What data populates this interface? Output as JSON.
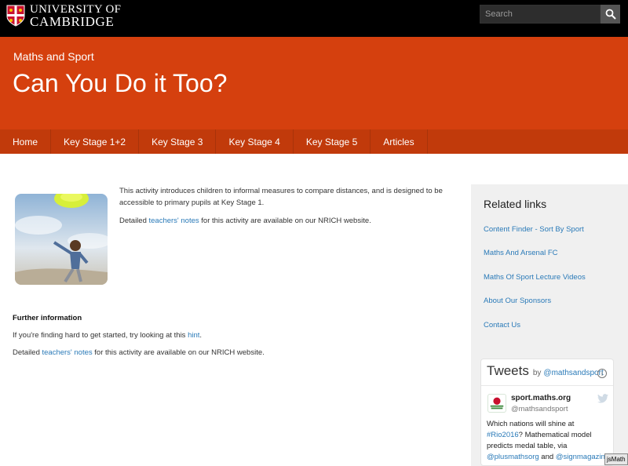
{
  "header": {
    "logo_line1": "UNIVERSITY OF",
    "logo_line2": "CAMBRIDGE",
    "search_placeholder": "Search"
  },
  "hero": {
    "section": "Maths and Sport",
    "title": "Can You Do it Too?"
  },
  "nav": {
    "items": [
      {
        "label": "Home"
      },
      {
        "label": "Key Stage 1+2"
      },
      {
        "label": "Key Stage 3"
      },
      {
        "label": "Key Stage 4"
      },
      {
        "label": "Key Stage 5"
      },
      {
        "label": "Articles"
      }
    ]
  },
  "main": {
    "intro_text": "This activity introduces children to informal measures to compare distances, and is designed to be accessible to primary pupils at Key Stage 1.",
    "notes_prefix": "Detailed ",
    "notes_link": "teachers' notes",
    "notes_suffix": " for this activity are available on our NRICH website.",
    "further_heading": "Further information",
    "hint_prefix": "If you're finding hard to get started, try looking at this ",
    "hint_link": "hint",
    "hint_suffix": "."
  },
  "sidebar": {
    "related_title": "Related links",
    "links": [
      {
        "label": "Content Finder - Sort By Sport"
      },
      {
        "label": "Maths And Arsenal FC"
      },
      {
        "label": "Maths Of Sport Lecture Videos"
      },
      {
        "label": "About Our Sponsors"
      },
      {
        "label": "Contact Us"
      }
    ]
  },
  "tweets": {
    "title": "Tweets",
    "by": "by",
    "account": "@mathsandsport",
    "info_glyph": "i",
    "tweet": {
      "name": "sport.maths.org",
      "handle": "@mathsandsport",
      "line1": "Which nations will shine at",
      "line2_tag": "#Rio2016",
      "line2_rest": "? Mathematical model",
      "line3": "predicts medal table, via",
      "line4_tag1": "@plusmathsorg",
      "line4_and": " and ",
      "line4_tag2": "@signmagazine"
    }
  },
  "badge": {
    "label": "jsMath"
  },
  "colors": {
    "brand_orange": "#d5400e",
    "nav_orange": "#c13a0b",
    "link_blue": "#2a7ab8",
    "sidebar_grey": "#f0f0f0"
  }
}
